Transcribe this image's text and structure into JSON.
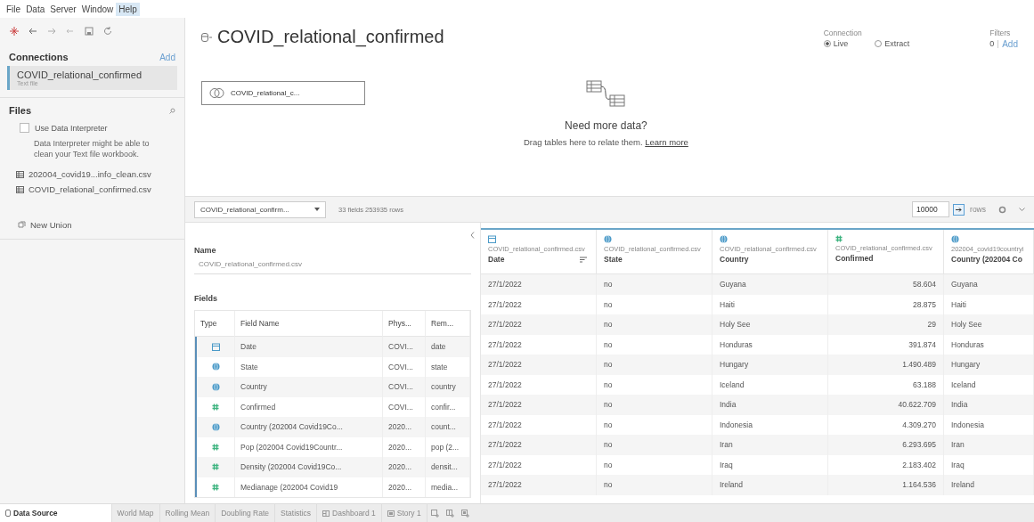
{
  "menu": [
    {
      "label": "File",
      "selected": false
    },
    {
      "label": "Data",
      "selected": false
    },
    {
      "label": "Server",
      "selected": false
    },
    {
      "label": "Window",
      "selected": false
    },
    {
      "label": "Help",
      "selected": true
    }
  ],
  "connections": {
    "title": "Connections",
    "add": "Add",
    "items": [
      {
        "name": "COVID_relational_confirmed",
        "type": "Text file",
        "selected": true
      }
    ]
  },
  "files": {
    "title": "Files",
    "interpreter": {
      "label": "Use Data Interpreter",
      "checked": false,
      "hint": "Data Interpreter might be able to clean your Text file workbook."
    },
    "items": [
      {
        "name": "202004_covid19...info_clean.csv"
      },
      {
        "name": "COVID_relational_confirmed.csv"
      }
    ],
    "new_union": "New Union"
  },
  "canvas": {
    "title": "COVID_relational_confirmed",
    "connection": {
      "label": "Connection",
      "options": [
        {
          "label": "Live",
          "selected": true
        },
        {
          "label": "Extract",
          "selected": false
        }
      ]
    },
    "filters": {
      "label": "Filters",
      "count": "0",
      "add": "Add"
    },
    "table_chip": "COVID_relational_c...",
    "empty": {
      "title": "Need more data?",
      "text": "Drag tables here to relate them.",
      "link": "Learn more"
    }
  },
  "toolbar": {
    "table_select": "COVID_relational_confirm...",
    "info": "33 fields 253935 rows",
    "rows_value": "10000",
    "rows_label": "rows"
  },
  "metadata": {
    "name_label": "Name",
    "name_value": "COVID_relational_confirmed.csv",
    "fields_label": "Fields",
    "columns": [
      "Type",
      "Field Name",
      "Phys...",
      "Rem..."
    ],
    "rows": [
      {
        "kind": "date",
        "name": "Date",
        "physical": "COVI...",
        "remote": "date"
      },
      {
        "kind": "geo",
        "name": "State",
        "physical": "COVI...",
        "remote": "state"
      },
      {
        "kind": "geo",
        "name": "Country",
        "physical": "COVI...",
        "remote": "country"
      },
      {
        "kind": "number",
        "name": "Confirmed",
        "physical": "COVI...",
        "remote": "confir..."
      },
      {
        "kind": "geo",
        "name": "Country (202004 Covid19Co...",
        "physical": "2020...",
        "remote": "count..."
      },
      {
        "kind": "number",
        "name": "Pop (202004 Covid19Countr...",
        "physical": "2020...",
        "remote": "pop (2..."
      },
      {
        "kind": "number",
        "name": "Density (202004 Covid19Co...",
        "physical": "2020...",
        "remote": "densit..."
      },
      {
        "kind": "number",
        "name": "Medianage (202004 Covid19",
        "physical": "2020...",
        "remote": "media..."
      }
    ]
  },
  "grid": {
    "columns": [
      {
        "kind": "date",
        "source": "COVID_relational_confirmed.csv",
        "name": "Date",
        "sorted": true
      },
      {
        "kind": "geo",
        "source": "COVID_relational_confirmed.csv",
        "name": "State",
        "sorted": false
      },
      {
        "kind": "geo",
        "source": "COVID_relational_confirmed.csv",
        "name": "Country",
        "sorted": false
      },
      {
        "kind": "number",
        "source": "COVID_relational_confirmed.csv",
        "name": "Confirmed",
        "sorted": false
      },
      {
        "kind": "geo",
        "source": "202004_covid19countryi",
        "name": "Country (202004 Co",
        "sorted": false
      }
    ],
    "rows": [
      [
        "27/1/2022",
        "no",
        "Guyana",
        "58.604",
        "Guyana"
      ],
      [
        "27/1/2022",
        "no",
        "Haiti",
        "28.875",
        "Haiti"
      ],
      [
        "27/1/2022",
        "no",
        "Holy See",
        "29",
        "Holy See"
      ],
      [
        "27/1/2022",
        "no",
        "Honduras",
        "391.874",
        "Honduras"
      ],
      [
        "27/1/2022",
        "no",
        "Hungary",
        "1.490.489",
        "Hungary"
      ],
      [
        "27/1/2022",
        "no",
        "Iceland",
        "63.188",
        "Iceland"
      ],
      [
        "27/1/2022",
        "no",
        "India",
        "40.622.709",
        "India"
      ],
      [
        "27/1/2022",
        "no",
        "Indonesia",
        "4.309.270",
        "Indonesia"
      ],
      [
        "27/1/2022",
        "no",
        "Iran",
        "6.293.695",
        "Iran"
      ],
      [
        "27/1/2022",
        "no",
        "Iraq",
        "2.183.402",
        "Iraq"
      ],
      [
        "27/1/2022",
        "no",
        "Ireland",
        "1.164.536",
        "Ireland"
      ]
    ]
  },
  "tabs": [
    {
      "label": "Data Source",
      "kind": "source",
      "selected": true
    },
    {
      "label": "World Map",
      "kind": "sheet",
      "selected": false
    },
    {
      "label": "Rolling Mean",
      "kind": "sheet",
      "selected": false
    },
    {
      "label": "Doubling Rate",
      "kind": "sheet",
      "selected": false
    },
    {
      "label": "Statistics",
      "kind": "sheet",
      "selected": false
    },
    {
      "label": "Dashboard 1",
      "kind": "dashboard",
      "selected": false
    },
    {
      "label": "Story 1",
      "kind": "story",
      "selected": false
    }
  ]
}
